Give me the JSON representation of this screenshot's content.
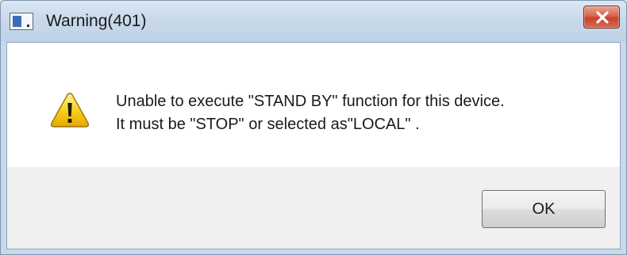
{
  "window": {
    "title": "Warning(401)",
    "app_icon": "application-window-icon",
    "close_icon": "close-icon"
  },
  "message": {
    "icon": "warning-icon",
    "line1": "Unable to execute \"STAND BY\" function for this device.",
    "line2": "It must be \"STOP\" or selected as\"LOCAL\" ."
  },
  "buttons": {
    "ok_label": "OK"
  },
  "colors": {
    "close_button": "#c8432e",
    "warning_yellow": "#f5c400",
    "titlebar": "#c8d9ea"
  }
}
